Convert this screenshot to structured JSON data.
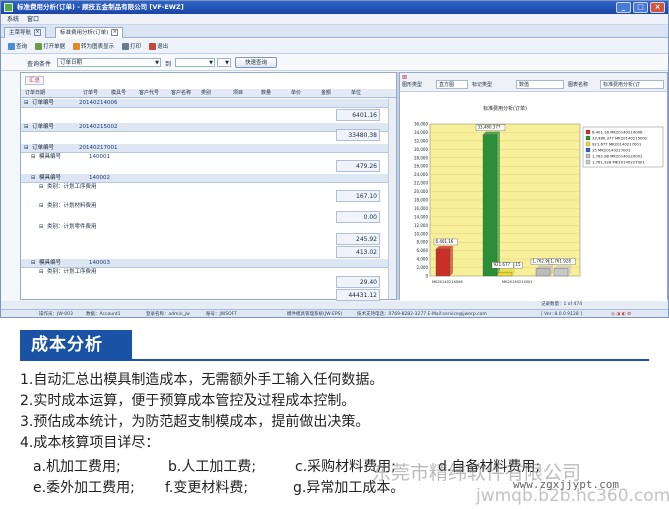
{
  "window": {
    "title": "标准费用分析(订单) - 顾技五金制品有限公司 [VF-EWZ]",
    "buttons": [
      "_",
      "□",
      "×"
    ]
  },
  "menu": [
    "系统",
    "窗口"
  ],
  "tabs": [
    {
      "label": "主菜导航"
    },
    {
      "label": "标准费用分析(订单)"
    }
  ],
  "toolbar": {
    "items": [
      "查询",
      "打开单据",
      "转为图表显示",
      "打印",
      "退出"
    ]
  },
  "filter": {
    "label": "查询条件",
    "field": "订单日期",
    "op": "到",
    "query_button": "快速查询"
  },
  "left": {
    "label": "汇总",
    "columns": [
      "订单日期",
      "订单号",
      "模具号",
      "客户代号",
      "客户名称",
      "类别",
      "项目",
      "数量",
      "单价",
      "金额",
      "单位"
    ],
    "rows": [
      {
        "indent": 0,
        "label": "订单编号",
        "value": "20140214006",
        "amount": "6401.16"
      },
      {
        "indent": 0,
        "label": "订单编号",
        "value": "20140215002",
        "amount": "33480.38"
      },
      {
        "indent": 0,
        "label": "订单编号",
        "value": "20140217001"
      },
      {
        "indent": 1,
        "label": "模具编号",
        "value": "140001",
        "amount": "479.26"
      },
      {
        "indent": 1,
        "label": "模具编号",
        "value": "140002"
      },
      {
        "indent": 2,
        "label": "类别：计划工序费用",
        "amount": "167.10"
      },
      {
        "indent": 2,
        "label": "类别：计划材料费用",
        "amount": "0.00"
      },
      {
        "indent": 2,
        "label": "类别：计划零件费用",
        "amount": "245.92"
      },
      {
        "amount": "413.02"
      },
      {
        "indent": 1,
        "label": "模具编号",
        "value": "140003"
      },
      {
        "indent": 2,
        "label": "类别：计划工序费用",
        "amount": "29.40"
      },
      {
        "amount": "44431.12"
      }
    ]
  },
  "right": {
    "selectors": [
      "图形类型",
      "直方图",
      "标记类型",
      "数值",
      "图表名称",
      "标准费用分析(订"
    ],
    "chart_title": "标准费用分析(订单)"
  },
  "chart_data": {
    "type": "bar",
    "title": "标准费用分析(订单)",
    "categories": [
      "MK20140214006",
      "MK20140215002",
      "MK20140217001",
      "MK20140217001",
      "MK20140227001"
    ],
    "x_tick_labels": [
      "MK20140214006",
      "MK20140215001"
    ],
    "values": [
      6401.16,
      33480.377,
      921.677,
      1762.98,
      1761.928
    ],
    "data_labels": [
      "6,401.16",
      "33,480.377",
      "921.677",
      "15",
      "1,762.98",
      "1,761.928"
    ],
    "extra_small_value": 15,
    "ylim": [
      0,
      36000
    ],
    "yticks": [
      0,
      2000,
      4000,
      6000,
      8000,
      10000,
      12000,
      14000,
      16000,
      18000,
      20000,
      22000,
      24000,
      26000,
      28000,
      30000,
      32000,
      34000,
      36000
    ],
    "legend": [
      {
        "label": "6,401.16 MK20140214006",
        "color": "#c83028"
      },
      {
        "label": "33,480.377 MK20140215002",
        "color": "#2a8f38"
      },
      {
        "label": "921.677 MK20140217001",
        "color": "#e8d838"
      },
      {
        "label": "15 MK20140217001",
        "color": "#2f5fc8"
      },
      {
        "label": "1,762.98 MK20140220001",
        "color": "#bcbcbc"
      },
      {
        "label": "1,761.928 MK20140227001",
        "color": "#c8c8c8"
      }
    ],
    "legend_position": "top-right",
    "background": "#f7ef9a"
  },
  "status": {
    "user": "操作员：JW-003",
    "account": "数据：Account1",
    "login": "登录名称：admin_jw",
    "company": "账号：JWSOFT",
    "system": "模件模具管理系统(JW-EPS)",
    "support": "技术支持电话：0769-8282-3277 E-Mail:service@jwerp.com",
    "version": "[ Ver: 8.0.0.9128 ]",
    "record": "记录数量：1 of 474"
  },
  "article": {
    "heading": "成本分析",
    "lines": [
      "1.自动汇总出模具制造成本，无需额外手工输入任何数据。",
      "2.实时成本运算，便于预算成本管控及过程成本控制。",
      "3.预估成本统计，为防范超支制模成本，提前做出决策。",
      "4.成本核算项目详尽："
    ],
    "items_row1": [
      "a.机加工费用;",
      "b.人工加工费;",
      "c.采购材料费用;",
      "d.自备材料费用;"
    ],
    "items_row2": [
      "e.委外加工费用;",
      "f.变更材料费;",
      "g.异常加工成本。"
    ]
  },
  "watermarks": [
    "东莞市精纬软件有限公司",
    "www.zgxjjypt.com",
    "jwmqb.b2b.hc360.com"
  ]
}
